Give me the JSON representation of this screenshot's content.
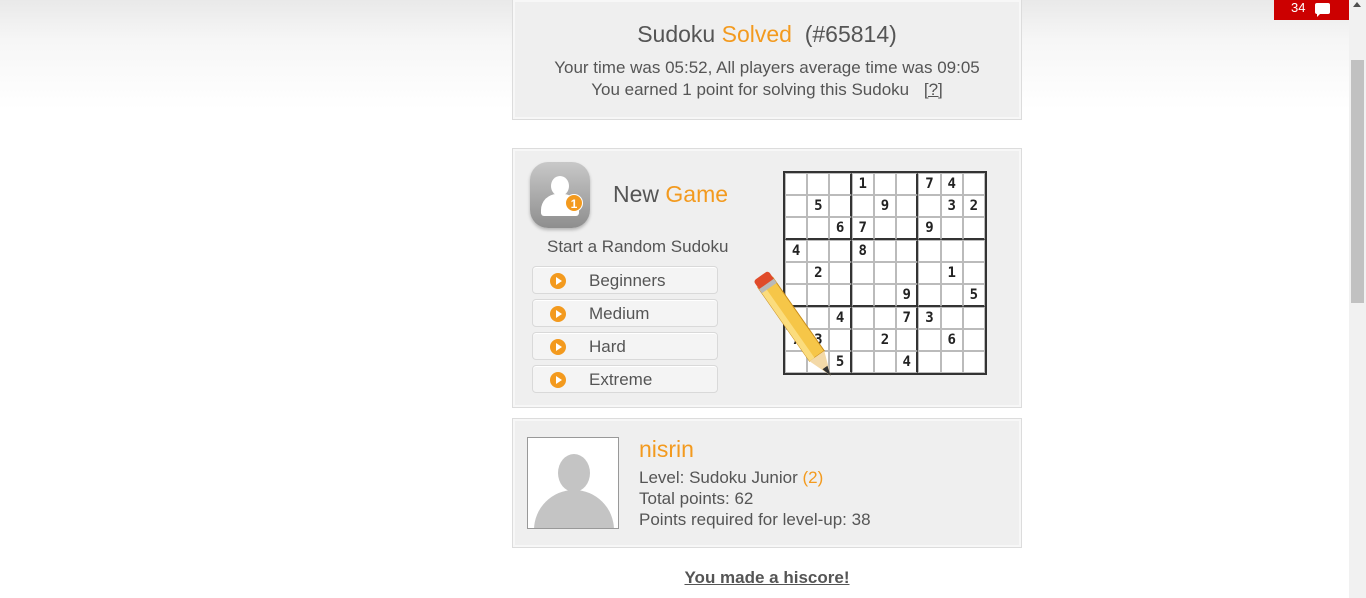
{
  "solved": {
    "title_prefix": "Sudoku",
    "title_accent": "Solved",
    "title_id": "(#65814)",
    "time_line": "Your time was 05:52, All players average time was 09:05",
    "points_line": "You earned 1 point for solving this Sudoku",
    "help_link": "[?]"
  },
  "new_game": {
    "title_prefix": "New",
    "title_accent": "Game",
    "badge": "1",
    "subtitle": "Start a Random Sudoku",
    "difficulties": [
      "Beginners",
      "Medium",
      "Hard",
      "Extreme"
    ],
    "grid": [
      [
        "",
        "",
        "",
        "1",
        "",
        "",
        "7",
        "4",
        ""
      ],
      [
        "",
        "5",
        "",
        "",
        "9",
        "",
        "",
        "3",
        "2"
      ],
      [
        "",
        "",
        "6",
        "7",
        "",
        "",
        "9",
        "",
        ""
      ],
      [
        "4",
        "",
        "",
        "8",
        "",
        "",
        "",
        "",
        ""
      ],
      [
        "",
        "2",
        "",
        "",
        "",
        "",
        "",
        "1",
        ""
      ],
      [
        "",
        "",
        "",
        "",
        "",
        "9",
        "",
        "",
        "5"
      ],
      [
        "",
        "",
        "4",
        "",
        "",
        "7",
        "3",
        "",
        ""
      ],
      [
        "7",
        "3",
        "",
        "",
        "2",
        "",
        "",
        "6",
        ""
      ],
      [
        "",
        "",
        "5",
        "",
        "",
        "4",
        "",
        "",
        ""
      ]
    ]
  },
  "profile": {
    "username": "nisrin",
    "level_label": "Level: Sudoku Junior",
    "level_number": "(2)",
    "total_points": "Total points: 62",
    "levelup": "Points required for level-up: 38"
  },
  "hiscore_link": "You made a hiscore!",
  "chat_badge": {
    "count": "34",
    "icon": "chat-bubble-icon"
  },
  "colors": {
    "accent": "#f39a1e",
    "badge_red": "#cc0000",
    "text": "#555555"
  }
}
